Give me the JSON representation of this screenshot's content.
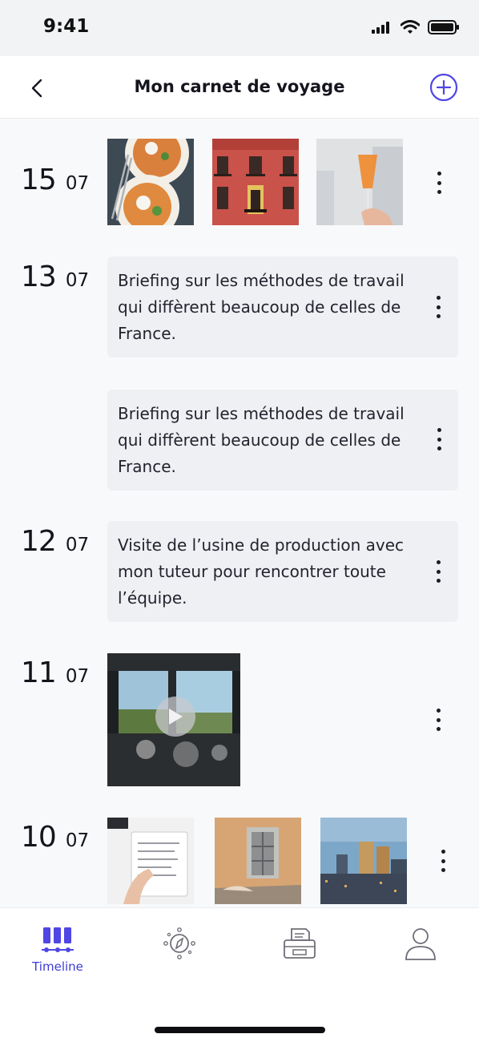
{
  "status_bar": {
    "time": "9:41",
    "icons": [
      "signal-icon",
      "wifi-icon",
      "battery-icon"
    ]
  },
  "header": {
    "title": "Mon carnet de voyage",
    "back_icon": "chevron-left-icon",
    "add_icon": "plus-circle-icon"
  },
  "colors": {
    "accent": "#4f46e5",
    "note_bg": "#eef0f3",
    "background": "#f8f9fb"
  },
  "entries": [
    {
      "day": "15",
      "month": "07",
      "type": "photos",
      "photos": [
        "pasta-photo",
        "building-facade-photo",
        "spritz-cocktail-photo"
      ]
    },
    {
      "day": "13",
      "month": "07",
      "type": "note",
      "text": "Briefing sur les méthodes de travail qui diffèrent beaucoup de celles de France."
    },
    {
      "day": "",
      "month": "",
      "type": "note",
      "text": "Briefing sur les méthodes de travail qui diffèrent beaucoup de celles de France."
    },
    {
      "day": "12",
      "month": "07",
      "type": "note",
      "text": "Visite de l’usine de production avec mon tuteur pour rencontrer toute l’équipe."
    },
    {
      "day": "11",
      "month": "07",
      "type": "video",
      "media": "train-cab-video"
    },
    {
      "day": "10",
      "month": "07",
      "type": "photos",
      "photos": [
        "notebook-writing-photo",
        "window-wall-photo",
        "city-skyline-photo"
      ]
    }
  ],
  "tabbar": {
    "tabs": [
      {
        "label": "Timeline",
        "icon": "timeline-icon",
        "active": true
      },
      {
        "label": "",
        "icon": "compass-icon",
        "active": false
      },
      {
        "label": "",
        "icon": "printer-icon",
        "active": false
      },
      {
        "label": "",
        "icon": "profile-icon",
        "active": false
      }
    ]
  }
}
